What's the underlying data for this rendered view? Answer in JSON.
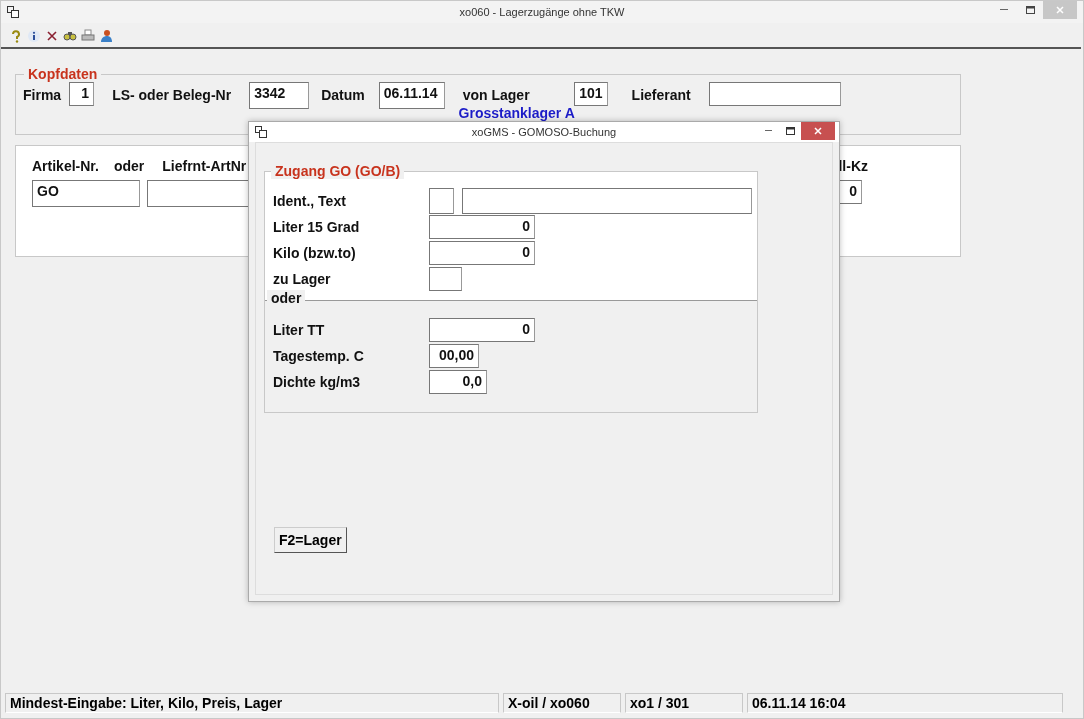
{
  "window": {
    "title": "xo060 - Lagerzugänge ohne TKW"
  },
  "header": {
    "title": "Kopfdaten",
    "fields": [
      {
        "label": "Firma",
        "value": "1"
      },
      {
        "label": "LS- oder Beleg-Nr",
        "value": "3342"
      },
      {
        "label": "Datum",
        "value": "06.11.14"
      },
      {
        "label": "von Lager",
        "value": "101",
        "note": "Grosstanklager A"
      },
      {
        "label": "Lieferant"
      }
    ]
  },
  "article": {
    "labels": [
      "Artikel-Nr.",
      "oder",
      "Liefrnt-ArtNr"
    ],
    "article_no": "GO",
    "flag_label": "ll-Kz",
    "flag_value": "0"
  },
  "dialog": {
    "title": "xoGMS - GOMOSO-Buchung",
    "group_title": "Zugang GO (GO/B)",
    "fields": [
      {
        "label": "Ident., Text",
        "kind": "ident"
      },
      {
        "label": "Liter 15 Grad",
        "value": "0",
        "kind": "wide"
      },
      {
        "label": "Kilo (bzw.to)",
        "value": "0",
        "kind": "wide"
      },
      {
        "label": "zu Lager",
        "kind": "tiny"
      }
    ],
    "separator": "oder",
    "fields2": [
      {
        "label": "Liter TT",
        "value": "0",
        "kind": "wide"
      },
      {
        "label": "Tagestemp. C",
        "value": "00,00",
        "kind": "small"
      },
      {
        "label": "Dichte kg/m3",
        "value": "0,0",
        "kind": "medium"
      }
    ],
    "button": "F2=Lager"
  },
  "status_bar": [
    "Mindest-Eingabe: Liter, Kilo, Preis, Lager",
    "X-oil / xo060",
    "xo1 / 301",
    "06.11.14 16:04"
  ]
}
